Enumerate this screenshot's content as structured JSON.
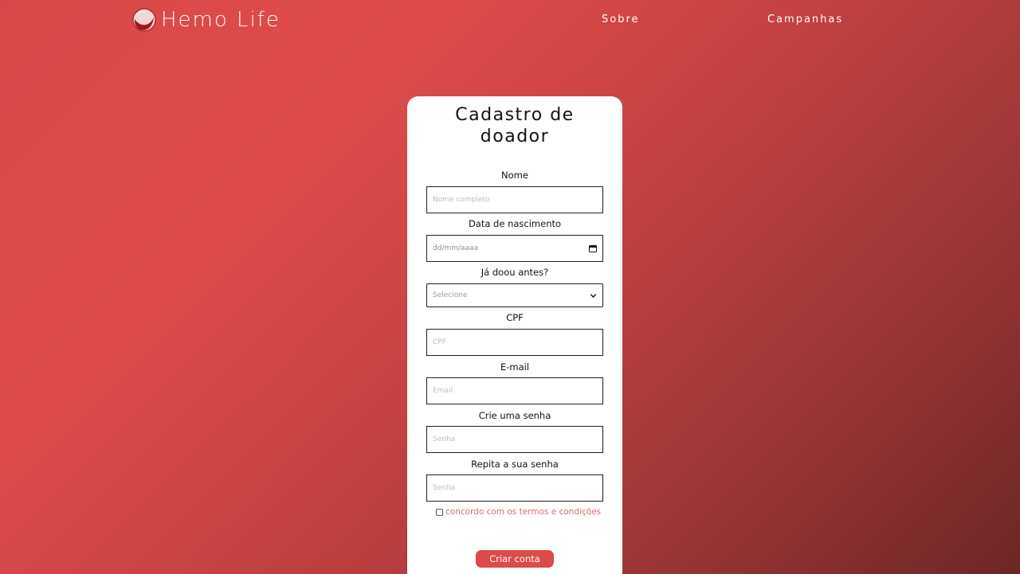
{
  "header": {
    "brand_name": "Hemo Life",
    "nav": {
      "sobre": "Sobre",
      "campanhas": "Campanhas"
    }
  },
  "form": {
    "title_line1": "Cadastro de",
    "title_line2": "doador",
    "fields": {
      "nome": {
        "label": "Nome",
        "placeholder": "Nome completo"
      },
      "nascimento": {
        "label": "Data de nascimento",
        "placeholder": "dd/mm/aaaa"
      },
      "doou": {
        "label": "Já doou antes?",
        "selected": "Selecione"
      },
      "cpf": {
        "label": "CPF",
        "placeholder": "CPF"
      },
      "email": {
        "label": "E-mail",
        "placeholder": "Email"
      },
      "senha": {
        "label": "Crie uma senha",
        "placeholder": "Senha"
      },
      "repita_senha": {
        "label": "Repita a sua senha",
        "placeholder": "Senha"
      }
    },
    "terms_label": "concordo com os termos e condições",
    "submit_label": "Criar conta"
  },
  "icons": {
    "logo": "blood-drop-logo",
    "date": "calendar-icon",
    "select": "chevron-down-icon"
  },
  "colors": {
    "accent": "#dc4a4a",
    "background_start": "#df4b4b",
    "background_end": "#6e2626",
    "terms_text": "#e06a6a"
  }
}
